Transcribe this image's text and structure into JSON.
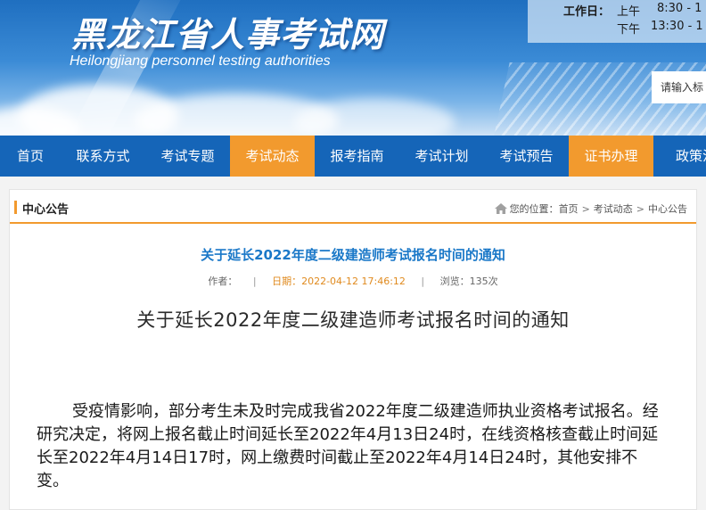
{
  "header": {
    "title": "黑龙江省人事考试网",
    "subtitle": "Heilongjiang personnel testing authorities",
    "worktime": {
      "label": "工作日：",
      "am_label": "上午",
      "am_time": "8:30 - 1",
      "pm_label": "下午",
      "pm_time": "13:30 - 1"
    },
    "search_placeholder": "请输入标"
  },
  "nav": {
    "items": [
      {
        "label": "首页",
        "active": false
      },
      {
        "label": "联系方式",
        "active": false
      },
      {
        "label": "考试专题",
        "active": false
      },
      {
        "label": "考试动态",
        "active": true
      },
      {
        "label": "报考指南",
        "active": false
      },
      {
        "label": "考试计划",
        "active": false
      },
      {
        "label": "考试预告",
        "active": false
      },
      {
        "label": "证书办理",
        "active": true
      },
      {
        "label": "政策法",
        "active": false
      }
    ]
  },
  "section": {
    "title": "中心公告",
    "breadcrumb": {
      "prefix": "您的位置：",
      "items": [
        "首页",
        "考试动态",
        "中心公告"
      ],
      "separator": ">"
    }
  },
  "article": {
    "title": "关于延长2022年度二级建造师考试报名时间的通知",
    "author_label": "作者：",
    "date_label": "日期：2022-04-12 17:46:12",
    "views_label": "浏览：135次",
    "heading": "关于延长2022年度二级建造师考试报名时间的通知",
    "body": "受疫情影响，部分考生未及时完成我省2022年度二级建造师执业资格考试报名。经研究决定，将网上报名截止时间延长至2022年4月13日24时，在线资格核查截止时间延长至2022年4月14日17时，网上缴费时间截止至2022年4月14日24时，其他安排不变。"
  },
  "colors": {
    "nav_bg": "#1565b8",
    "accent": "#f29a2e",
    "title_blue": "#1a78c8"
  }
}
